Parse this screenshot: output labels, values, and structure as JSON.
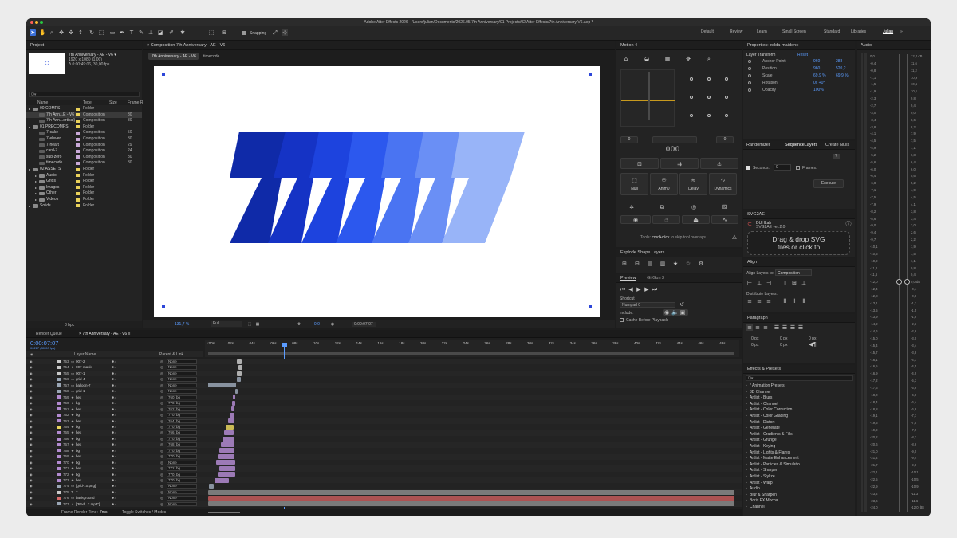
{
  "window": {
    "title": "Adobe After Effects 2026 - /Users/julian/Documents/2026.05 7th Anniversary/01 Projects/02 After Effects/7th Anniversary V6.aep *"
  },
  "toolbar": {
    "snapping": "Snapping"
  },
  "workspaces": [
    {
      "label": "Default"
    },
    {
      "label": "Review"
    },
    {
      "label": "Learn"
    },
    {
      "label": "Small Screen"
    },
    {
      "label": "Standard"
    },
    {
      "label": "Libraries"
    },
    {
      "label": "Julian"
    }
  ],
  "project": {
    "panel_label": "Project",
    "comp_name": "7th Anniversary - AE - V6 ▾",
    "comp_info1": "1920 x 1080 (1,00)",
    "comp_info2": "Δ 0:00:49:06, 30,00 fps",
    "search_placeholder": "Q▾",
    "columns": {
      "name": "Name",
      "type": "Type",
      "size": "Size",
      "frame": "Frame R"
    },
    "items": [
      {
        "name": "00 COMPS",
        "type": "Folder",
        "fr": "",
        "indent": 0,
        "folder": true,
        "color": "#e9d15a"
      },
      {
        "name": "7th Ann...E - V6",
        "type": "Composition",
        "fr": "30",
        "indent": 1,
        "color": "#e9d15a",
        "sel": true
      },
      {
        "name": "7th Ann...ertical)",
        "type": "Composition",
        "fr": "30",
        "indent": 1,
        "color": "#e9d15a"
      },
      {
        "name": "01 PRECOMPS",
        "type": "Folder",
        "fr": "",
        "indent": 0,
        "folder": true,
        "color": "#e9d15a"
      },
      {
        "name": "7-cake",
        "type": "Composition",
        "fr": "50",
        "indent": 1,
        "color": "#c9a9d8"
      },
      {
        "name": "7-eleven",
        "type": "Composition",
        "fr": "30",
        "indent": 1,
        "color": "#c9a9d8"
      },
      {
        "name": "7-heart",
        "type": "Composition",
        "fr": "29",
        "indent": 1,
        "color": "#c9a9d8"
      },
      {
        "name": "card-7",
        "type": "Composition",
        "fr": "24",
        "indent": 1,
        "color": "#c9a9d8"
      },
      {
        "name": "sub-zero",
        "type": "Composition",
        "fr": "30",
        "indent": 1,
        "color": "#c9a9d8"
      },
      {
        "name": "timecode",
        "type": "Composition",
        "fr": "30",
        "indent": 1,
        "color": "#c9a9d8"
      },
      {
        "name": "02 ASSETS",
        "type": "Folder",
        "fr": "",
        "indent": 0,
        "folder": true,
        "color": "#e9d15a"
      },
      {
        "name": "Audio",
        "type": "Folder",
        "fr": "",
        "indent": 1,
        "folder": true,
        "color": "#e9d15a"
      },
      {
        "name": "Grids",
        "type": "Folder",
        "fr": "",
        "indent": 1,
        "folder": true,
        "color": "#e9d15a"
      },
      {
        "name": "Images",
        "type": "Folder",
        "fr": "",
        "indent": 1,
        "folder": true,
        "color": "#e9d15a"
      },
      {
        "name": "Other",
        "type": "Folder",
        "fr": "",
        "indent": 1,
        "folder": true,
        "color": "#e9d15a"
      },
      {
        "name": "Videos",
        "type": "Folder",
        "fr": "",
        "indent": 1,
        "folder": true,
        "color": "#e9d15a"
      },
      {
        "name": "Solids",
        "type": "Folder",
        "fr": "",
        "indent": 0,
        "folder": true,
        "color": "#e9d15a"
      }
    ],
    "bpc": "8 bpc"
  },
  "composition": {
    "panel_label": "Composition 7th Anniversary - AE - V6",
    "tab": "7th Anniversary - AE - V6",
    "breadcrumb": "timecode",
    "zoom": "131,7",
    "resolution": "Full",
    "exposure": "+0,0",
    "timecode": "0:00:07:07"
  },
  "motion": {
    "title": "Motion 4",
    "left_value": "0",
    "right_value": "0",
    "center_value": "000",
    "actions": [
      {
        "label": "Null"
      },
      {
        "label": "Anim0"
      },
      {
        "label": "Delay"
      },
      {
        "label": "Dynamics"
      }
    ],
    "tip_prefix": "Tools: ",
    "tip_key": "cmd+click",
    "tip_suffix": " to skip tool overlays"
  },
  "explode": {
    "title": "Explode Shape Layers"
  },
  "preview": {
    "tab1": "Preview",
    "tab2": "GifGun 2",
    "shortcut_label": "Shortcut",
    "shortcut_value": "Numpad 0",
    "include_label": "Include:",
    "cache_label": "Cache Before Playback"
  },
  "properties": {
    "title": "Properties: zelda-maiden≡",
    "section": "Layer Transform",
    "reset": "Reset",
    "rows": [
      {
        "label": "Anchor Point",
        "v1": "960",
        "v2": "288"
      },
      {
        "label": "Position",
        "v1": "960",
        "v2": "520,2"
      },
      {
        "label": "Scale",
        "v1": "69,9 %",
        "v2": "69,9 %"
      },
      {
        "label": "Rotation",
        "v1": "0x +0°",
        "v2": ""
      },
      {
        "label": "Opacity",
        "v1": "100%",
        "v2": ""
      }
    ]
  },
  "sequencer": {
    "tabs": [
      {
        "label": "Randomizer"
      },
      {
        "label": "SequenceLayers"
      },
      {
        "label": "Create Nulls"
      }
    ],
    "help": "?",
    "seconds_label": "Seconds:",
    "seconds_value": "0",
    "frames_label": "Frames:",
    "execute": "Execute"
  },
  "svg2ae": {
    "title": "SVG2AE",
    "brand": "DUHLab",
    "version": "SVG2AE ver.2.0",
    "drop_line1": "Drag & drop SVG",
    "drop_line2": "files or click to"
  },
  "align": {
    "title": "Align",
    "align_to_label": "Align Layers to:",
    "align_to_value": "Composition",
    "distribute_label": "Distribute Layers:"
  },
  "paragraph": {
    "title": "Paragraph",
    "fields": [
      {
        "v": "0 px"
      },
      {
        "v": "0 px"
      },
      {
        "v": "0 px"
      },
      {
        "v": "0 px"
      },
      {
        "v": "0 px"
      }
    ]
  },
  "effects": {
    "title": "Effects & Presets",
    "search_placeholder": "Q▾",
    "items": [
      {
        "label": "* Animation Presets"
      },
      {
        "label": "3D Channel"
      },
      {
        "label": "Artlist - Blurs"
      },
      {
        "label": "Artlist - Channel"
      },
      {
        "label": "Artlist - Color Correction"
      },
      {
        "label": "Artlist - Color Grading"
      },
      {
        "label": "Artlist - Distort"
      },
      {
        "label": "Artlist - Generate"
      },
      {
        "label": "Artlist - Gradients & Fills"
      },
      {
        "label": "Artlist - Grunge"
      },
      {
        "label": "Artlist - Keying"
      },
      {
        "label": "Artlist - Lights & Flares"
      },
      {
        "label": "Artlist - Matte Enhancement"
      },
      {
        "label": "Artlist - Particles & Simulatio"
      },
      {
        "label": "Artlist - Sharpen"
      },
      {
        "label": "Artlist - Stylize"
      },
      {
        "label": "Artlist - Warp"
      },
      {
        "label": "Audio"
      },
      {
        "label": "Blur & Sharpen"
      },
      {
        "label": "Boris FX Mocha"
      },
      {
        "label": "Channel"
      }
    ]
  },
  "audio": {
    "title": "Audio",
    "left_scale": [
      "0,0",
      "-0,4",
      "-0,8",
      "-1,1",
      "-1,5",
      "-1,9",
      "-2,3",
      "-2,7",
      "-3,0",
      "-3,4",
      "-3,8",
      "-4,1",
      "-4,5",
      "-4,9",
      "-5,2",
      "-5,6",
      "-6,0",
      "-6,4",
      "-6,8",
      "-7,1",
      "-7,5",
      "-7,9",
      "-8,2",
      "-8,6",
      "-9,0",
      "-9,4",
      "-9,7",
      "-10,1",
      "-10,5",
      "-10,9",
      "-11,2",
      "-11,6",
      "-12,0",
      "-12,4",
      "-12,8",
      "-13,1",
      "-13,5",
      "-13,9",
      "-14,2",
      "-14,6",
      "-15,0",
      "-15,4",
      "-15,7",
      "-16,1",
      "-16,5",
      "-16,9",
      "-17,2",
      "-17,6",
      "-18,0",
      "-18,4",
      "-18,8",
      "-19,1",
      "-19,5",
      "-19,9",
      "-20,2",
      "-20,6",
      "-21,0",
      "-21,4",
      "-21,7",
      "-22,1",
      "-22,5",
      "-22,9",
      "-23,2",
      "-23,6",
      "-24,0"
    ],
    "right_scale": [
      "12,0 dB",
      "11,6",
      "11,2",
      "10,9",
      "10,5",
      "10,1",
      "9,8",
      "9,4",
      "9,0",
      "8,6",
      "8,2",
      "7,9",
      "7,5",
      "7,1",
      "6,8",
      "6,4",
      "6,0",
      "5,6",
      "5,2",
      "4,9",
      "4,5",
      "4,1",
      "3,8",
      "3,4",
      "3,0",
      "2,6",
      "2,2",
      "1,9",
      "1,5",
      "1,1",
      "0,8",
      "0,4",
      "0,0 dB",
      "-0,4",
      "-0,8",
      "-1,1",
      "-1,5",
      "-1,9",
      "-2,3",
      "-2,6",
      "-3,0",
      "-3,4",
      "-3,8",
      "-4,1",
      "-4,5",
      "-4,9",
      "-5,3",
      "-5,6",
      "-6,0",
      "-6,4",
      "-6,8",
      "-7,1",
      "-7,5",
      "-7,9",
      "-8,3",
      "-8,6",
      "-9,0",
      "-9,4",
      "-9,8",
      "-10,1",
      "-10,5",
      "-10,9",
      "-11,3",
      "-11,6",
      "-12,0 dB"
    ]
  },
  "timeline": {
    "render_queue": "Render Queue",
    "tab": "7th Anniversary - AE - V6",
    "timecode": "0:00:07:07",
    "timecode_sub": "00217 (30,00 fps)",
    "col_layer": "Layer Name",
    "col_parent": "Parent & Link",
    "ruler": [
      "):00s",
      "02s",
      "04s",
      "06s",
      "08s",
      "10s",
      "12s",
      "14s",
      "16s",
      "18s",
      "20s",
      "22s",
      "24s",
      "26s",
      "28s",
      "30s",
      "32s",
      "34s",
      "36s",
      "38s",
      "40s",
      "42s",
      "44s",
      "46s",
      "48s"
    ],
    "layers": [
      {
        "num": "753",
        "name": "007-2",
        "parent": "None",
        "color": "#c9c9c9",
        "icon": "▭"
      },
      {
        "num": "754",
        "name": "007-mask",
        "parent": "None",
        "color": "#c9c9c9",
        "icon": "★"
      },
      {
        "num": "755",
        "name": "007-1",
        "parent": "None",
        "color": "#c9c9c9",
        "icon": "▭"
      },
      {
        "num": "756",
        "name": "grid-4",
        "parent": "None",
        "color": "#9aa6b5",
        "icon": "▭"
      },
      {
        "num": "757",
        "name": "balloon-7",
        "parent": "None",
        "color": "#9aa6b5",
        "icon": "▭"
      },
      {
        "num": "758",
        "name": "grid-1",
        "parent": "None",
        "color": "#9aa6b5",
        "icon": "▭"
      },
      {
        "num": "759",
        "name": "hex",
        "parent": "760. bg",
        "color": "#b28ad0",
        "icon": "★"
      },
      {
        "num": "760",
        "name": "bg",
        "parent": "770. bg",
        "color": "#b28ad0",
        "icon": "★"
      },
      {
        "num": "761",
        "name": "hex",
        "parent": "762. bg",
        "color": "#b28ad0",
        "icon": "★"
      },
      {
        "num": "762",
        "name": "bg",
        "parent": "770. bg",
        "color": "#b28ad0",
        "icon": "★"
      },
      {
        "num": "763",
        "name": "hex",
        "parent": "764. bg",
        "color": "#b28ad0",
        "icon": "★"
      },
      {
        "num": "764",
        "name": "bg",
        "parent": "770. bg",
        "color": "#e8d55e",
        "icon": "★"
      },
      {
        "num": "765",
        "name": "hex",
        "parent": "766. bg",
        "color": "#b28ad0",
        "icon": "★"
      },
      {
        "num": "766",
        "name": "bg",
        "parent": "770. bg",
        "color": "#b28ad0",
        "icon": "★"
      },
      {
        "num": "767",
        "name": "hex",
        "parent": "768. bg",
        "color": "#b28ad0",
        "icon": "★"
      },
      {
        "num": "768",
        "name": "bg",
        "parent": "770. bg",
        "color": "#b28ad0",
        "icon": "★"
      },
      {
        "num": "769",
        "name": "hex",
        "parent": "770. bg",
        "color": "#b28ad0",
        "icon": "★"
      },
      {
        "num": "770",
        "name": "bg",
        "parent": "None",
        "color": "#b28ad0",
        "icon": "★"
      },
      {
        "num": "771",
        "name": "hex",
        "parent": "772. bg",
        "color": "#b28ad0",
        "icon": "★"
      },
      {
        "num": "772",
        "name": "bg",
        "parent": "770. bg",
        "color": "#b28ad0",
        "icon": "★"
      },
      {
        "num": "773",
        "name": "hex",
        "parent": "770. bg",
        "color": "#b28ad0",
        "icon": "★"
      },
      {
        "num": "774",
        "name": "[grid-10.png]",
        "parent": "None",
        "color": "#9aa6b5",
        "icon": "▭"
      },
      {
        "num": "775",
        "name": "7",
        "parent": "None",
        "color": "#c9c9c9",
        "icon": "T"
      },
      {
        "num": "776",
        "name": "background",
        "parent": "None",
        "color": "#d66a6a",
        "icon": "▭"
      },
      {
        "num": "777",
        "name": "[\"Red...2.mp3\"]",
        "parent": "None",
        "color": "#9aa6b5",
        "icon": "♪"
      }
    ],
    "frame_render_label": "Frame Render Time:",
    "frame_render_value": "7ms",
    "toggle_label": "Toggle Switches / Modes"
  }
}
